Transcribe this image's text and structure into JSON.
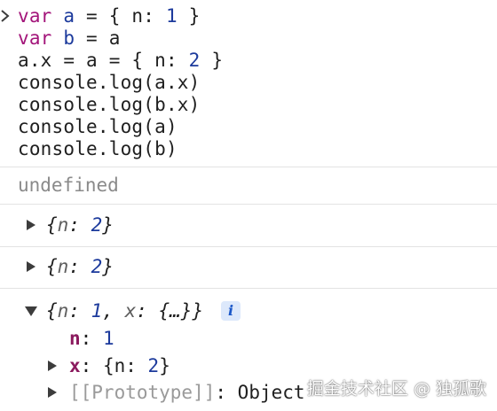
{
  "console": {
    "input_lines": [
      {
        "t1": "var",
        "t2": " a",
        "t3": " = { n: ",
        "t4": "1",
        "t5": " }"
      },
      {
        "t1": "var",
        "t2": " b",
        "t3": " = a",
        "t4": "",
        "t5": ""
      },
      {
        "t1": "",
        "t2": "",
        "t3": "a.x = a = { n: ",
        "t4": "2",
        "t5": " }"
      },
      {
        "t1": "",
        "t2": "",
        "t3": "console.log(a.x)",
        "t4": "",
        "t5": ""
      },
      {
        "t1": "",
        "t2": "",
        "t3": "console.log(b.x)",
        "t4": "",
        "t5": ""
      },
      {
        "t1": "",
        "t2": "",
        "t3": "console.log(a)",
        "t4": "",
        "t5": ""
      },
      {
        "t1": "",
        "t2": "",
        "t3": "console.log(b)",
        "t4": "",
        "t5": ""
      }
    ],
    "result_undefined": "undefined",
    "log1": {
      "open": "{",
      "key": "n",
      "colon": ": ",
      "value": "2",
      "close": "}"
    },
    "log2": {
      "open": "{",
      "key": "n",
      "colon": ": ",
      "value": "2",
      "close": "}"
    },
    "log3": {
      "open": "{",
      "k1": "n",
      "c1": ": ",
      "v1": "1",
      "comma": ", ",
      "k2": "x",
      "c2": ": ",
      "v2": "{…}",
      "close": "}",
      "info": "i"
    },
    "prop_n": {
      "key": "n",
      "colon": ": ",
      "value": "1"
    },
    "prop_x": {
      "key": "x",
      "colon": ": ",
      "open": "{n: ",
      "value": "2",
      "close": "}"
    },
    "prop_proto": {
      "key": "[[Prototype]]",
      "colon": ": ",
      "value": "Object"
    }
  },
  "watermark": "掘金技术社区 @ 独孤歌",
  "colors": {
    "keyword": "#a3157a",
    "variable": "#1c3a9c",
    "number": "#1c3a9c",
    "result_gray": "#8a8a8a",
    "property_key": "#8b1a5e",
    "info_badge_bg": "#dce8fb",
    "separator": "#e3e3e3"
  }
}
